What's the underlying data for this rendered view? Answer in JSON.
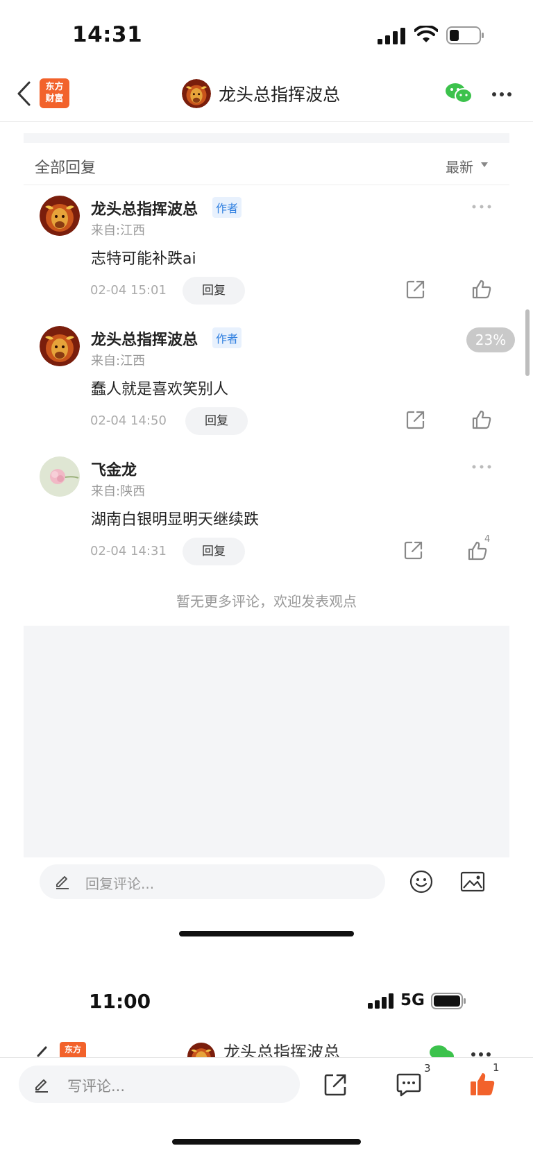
{
  "status_bar": {
    "time": "14:31"
  },
  "nav": {
    "logo_line1": "东方",
    "logo_line2": "财富",
    "title": "龙头总指挥波总"
  },
  "section": {
    "title": "全部回复",
    "sort_label": "最新"
  },
  "comments": [
    {
      "name": "龙头总指挥波总",
      "badge": "作者",
      "location": "来自:江西",
      "text": "志特可能补跌ai",
      "time": "02-04 15:01",
      "reply_label": "回复",
      "likes": ""
    },
    {
      "name": "龙头总指挥波总",
      "badge": "作者",
      "location": "来自:江西",
      "text": "蠢人就是喜欢笑别人",
      "time": "02-04 14:50",
      "reply_label": "回复",
      "likes": ""
    },
    {
      "name": "飞金龙",
      "badge": "",
      "location": "来自:陕西",
      "text": "湖南白银明显明天继续跌",
      "time": "02-04 14:31",
      "reply_label": "回复",
      "likes": "4"
    }
  ],
  "scroll_percent": "23%",
  "no_more_text": "暂无更多评论，欢迎发表观点",
  "reply_input": {
    "placeholder": "回复评论..."
  },
  "second_screen": {
    "status_time": "11:00",
    "network": "5G",
    "logo_text": "东方",
    "title_peek": "龙头总指挥波总",
    "comment_placeholder": "写评论...",
    "comment_count": "3",
    "like_count": "1"
  },
  "colors": {
    "brand_orange": "#f2622b",
    "author_badge_blue": "#2f7fe0",
    "wechat_green": "#3cc24c",
    "like_orange": "#f2622b"
  },
  "icons": [
    "back-arrow-icon",
    "wechat-icon",
    "more-icon",
    "sort-caret-icon",
    "share-icon",
    "like-icon",
    "pen-icon",
    "emoji-icon",
    "image-icon",
    "comment-icon"
  ]
}
